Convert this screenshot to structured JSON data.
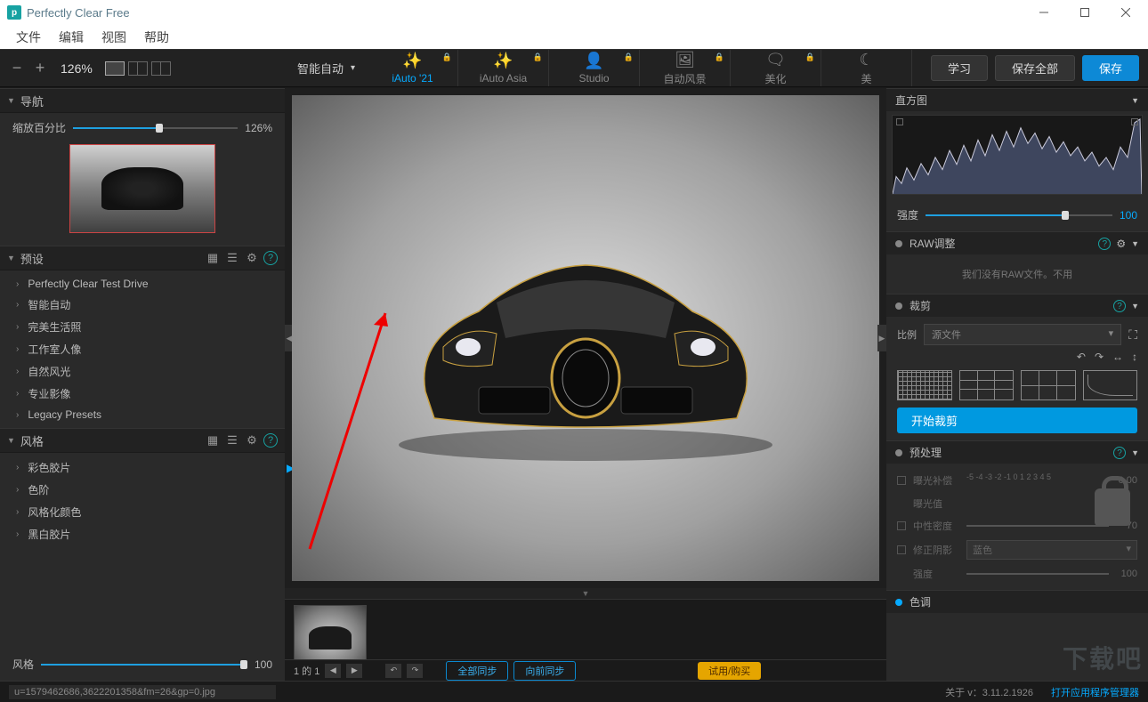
{
  "window": {
    "title": "Perfectly Clear Free"
  },
  "menu": {
    "file": "文件",
    "edit": "编辑",
    "view": "视图",
    "help": "帮助"
  },
  "toolbar": {
    "zoom": "126%",
    "smart_auto": "智能自动",
    "presets_top": [
      {
        "label": "iAuto '21",
        "active": true,
        "locked": true
      },
      {
        "label": "iAuto Asia",
        "active": false,
        "locked": true
      },
      {
        "label": "Studio",
        "active": false,
        "locked": true
      },
      {
        "label": "自动风景",
        "active": false,
        "locked": true
      },
      {
        "label": "美化",
        "active": false,
        "locked": true
      },
      {
        "label": "美",
        "active": false,
        "locked": true
      }
    ],
    "learn": "学习",
    "save_all": "保存全部",
    "save": "保存"
  },
  "left": {
    "nav": {
      "title": "导航",
      "zoom_label": "缩放百分比",
      "zoom_val": "126%"
    },
    "presets": {
      "title": "预设",
      "items": [
        "Perfectly Clear Test Drive",
        "智能自动",
        "完美生活照",
        "工作室人像",
        "自然风光",
        "专业影像",
        "Legacy Presets"
      ]
    },
    "styles": {
      "title": "风格",
      "items": [
        "彩色胶片",
        "色阶",
        "风格化颜色",
        "黑白胶片"
      ]
    },
    "style_slider_label": "风格",
    "style_slider_val": "100"
  },
  "right": {
    "hist_title": "直方图",
    "intensity_label": "强度",
    "intensity_val": "100",
    "raw_title": "RAW调整",
    "raw_msg": "我们没有RAW文件。不用",
    "crop": {
      "title": "裁剪",
      "ratio_label": "比例",
      "ratio_value": "源文件",
      "start": "开始裁剪"
    },
    "pre": {
      "title": "预处理",
      "exp_comp": "曝光补偿",
      "exp_scale": "-5 -4 -3 -2 -1  0  1  2  3  4  5",
      "exp_val": "0.00",
      "exp": "曝光值",
      "neutral": "中性密度",
      "neutral_val": "70",
      "fix_shade": "修正阴影",
      "fix_sel": "蓝色",
      "strength": "强度",
      "strength_val": "100"
    },
    "tone_title": "色调"
  },
  "bottom": {
    "page": "1 的 1",
    "sync_all": "全部同步",
    "sync_fwd": "向前同步",
    "trial": "试用/购买"
  },
  "status": {
    "filename": "u=1579462686,3622201358&fm=26&gp=0.jpg",
    "version": "关于 v：3.11.2.1926",
    "pm": "打开应用程序管理器"
  },
  "watermark": "下载吧"
}
